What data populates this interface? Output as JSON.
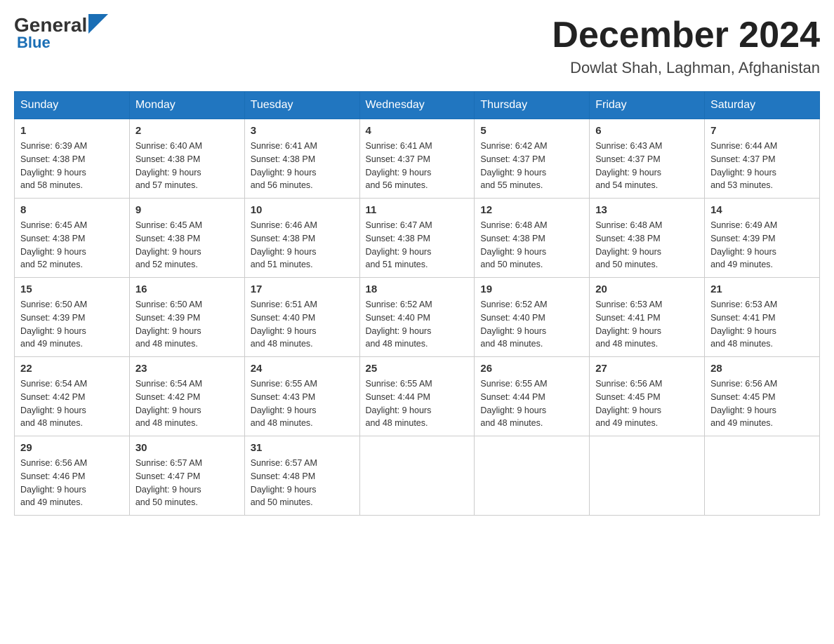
{
  "header": {
    "logo_general": "General",
    "logo_blue": "Blue",
    "month_title": "December 2024",
    "location": "Dowlat Shah, Laghman, Afghanistan"
  },
  "weekdays": [
    "Sunday",
    "Monday",
    "Tuesday",
    "Wednesday",
    "Thursday",
    "Friday",
    "Saturday"
  ],
  "weeks": [
    [
      {
        "day": "1",
        "sunrise": "6:39 AM",
        "sunset": "4:38 PM",
        "daylight": "9 hours and 58 minutes."
      },
      {
        "day": "2",
        "sunrise": "6:40 AM",
        "sunset": "4:38 PM",
        "daylight": "9 hours and 57 minutes."
      },
      {
        "day": "3",
        "sunrise": "6:41 AM",
        "sunset": "4:38 PM",
        "daylight": "9 hours and 56 minutes."
      },
      {
        "day": "4",
        "sunrise": "6:41 AM",
        "sunset": "4:37 PM",
        "daylight": "9 hours and 56 minutes."
      },
      {
        "day": "5",
        "sunrise": "6:42 AM",
        "sunset": "4:37 PM",
        "daylight": "9 hours and 55 minutes."
      },
      {
        "day": "6",
        "sunrise": "6:43 AM",
        "sunset": "4:37 PM",
        "daylight": "9 hours and 54 minutes."
      },
      {
        "day": "7",
        "sunrise": "6:44 AM",
        "sunset": "4:37 PM",
        "daylight": "9 hours and 53 minutes."
      }
    ],
    [
      {
        "day": "8",
        "sunrise": "6:45 AM",
        "sunset": "4:38 PM",
        "daylight": "9 hours and 52 minutes."
      },
      {
        "day": "9",
        "sunrise": "6:45 AM",
        "sunset": "4:38 PM",
        "daylight": "9 hours and 52 minutes."
      },
      {
        "day": "10",
        "sunrise": "6:46 AM",
        "sunset": "4:38 PM",
        "daylight": "9 hours and 51 minutes."
      },
      {
        "day": "11",
        "sunrise": "6:47 AM",
        "sunset": "4:38 PM",
        "daylight": "9 hours and 51 minutes."
      },
      {
        "day": "12",
        "sunrise": "6:48 AM",
        "sunset": "4:38 PM",
        "daylight": "9 hours and 50 minutes."
      },
      {
        "day": "13",
        "sunrise": "6:48 AM",
        "sunset": "4:38 PM",
        "daylight": "9 hours and 50 minutes."
      },
      {
        "day": "14",
        "sunrise": "6:49 AM",
        "sunset": "4:39 PM",
        "daylight": "9 hours and 49 minutes."
      }
    ],
    [
      {
        "day": "15",
        "sunrise": "6:50 AM",
        "sunset": "4:39 PM",
        "daylight": "9 hours and 49 minutes."
      },
      {
        "day": "16",
        "sunrise": "6:50 AM",
        "sunset": "4:39 PM",
        "daylight": "9 hours and 48 minutes."
      },
      {
        "day": "17",
        "sunrise": "6:51 AM",
        "sunset": "4:40 PM",
        "daylight": "9 hours and 48 minutes."
      },
      {
        "day": "18",
        "sunrise": "6:52 AM",
        "sunset": "4:40 PM",
        "daylight": "9 hours and 48 minutes."
      },
      {
        "day": "19",
        "sunrise": "6:52 AM",
        "sunset": "4:40 PM",
        "daylight": "9 hours and 48 minutes."
      },
      {
        "day": "20",
        "sunrise": "6:53 AM",
        "sunset": "4:41 PM",
        "daylight": "9 hours and 48 minutes."
      },
      {
        "day": "21",
        "sunrise": "6:53 AM",
        "sunset": "4:41 PM",
        "daylight": "9 hours and 48 minutes."
      }
    ],
    [
      {
        "day": "22",
        "sunrise": "6:54 AM",
        "sunset": "4:42 PM",
        "daylight": "9 hours and 48 minutes."
      },
      {
        "day": "23",
        "sunrise": "6:54 AM",
        "sunset": "4:42 PM",
        "daylight": "9 hours and 48 minutes."
      },
      {
        "day": "24",
        "sunrise": "6:55 AM",
        "sunset": "4:43 PM",
        "daylight": "9 hours and 48 minutes."
      },
      {
        "day": "25",
        "sunrise": "6:55 AM",
        "sunset": "4:44 PM",
        "daylight": "9 hours and 48 minutes."
      },
      {
        "day": "26",
        "sunrise": "6:55 AM",
        "sunset": "4:44 PM",
        "daylight": "9 hours and 48 minutes."
      },
      {
        "day": "27",
        "sunrise": "6:56 AM",
        "sunset": "4:45 PM",
        "daylight": "9 hours and 49 minutes."
      },
      {
        "day": "28",
        "sunrise": "6:56 AM",
        "sunset": "4:45 PM",
        "daylight": "9 hours and 49 minutes."
      }
    ],
    [
      {
        "day": "29",
        "sunrise": "6:56 AM",
        "sunset": "4:46 PM",
        "daylight": "9 hours and 49 minutes."
      },
      {
        "day": "30",
        "sunrise": "6:57 AM",
        "sunset": "4:47 PM",
        "daylight": "9 hours and 50 minutes."
      },
      {
        "day": "31",
        "sunrise": "6:57 AM",
        "sunset": "4:48 PM",
        "daylight": "9 hours and 50 minutes."
      },
      null,
      null,
      null,
      null
    ]
  ],
  "labels": {
    "sunrise": "Sunrise:",
    "sunset": "Sunset:",
    "daylight": "Daylight:"
  }
}
